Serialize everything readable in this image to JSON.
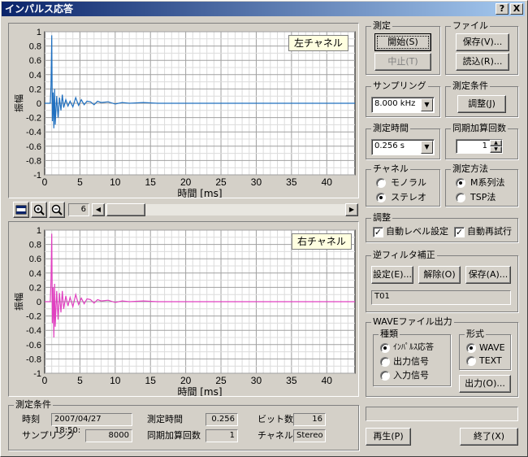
{
  "window": {
    "title": "インパルス応答",
    "help_button": "?",
    "close_button": "X"
  },
  "charts": {
    "left_label": "左チャネル",
    "right_label": "右チャネル",
    "zoom_value": "6"
  },
  "chart_data": [
    {
      "type": "line",
      "title": "左チャネル",
      "xlabel": "時間 [ms]",
      "ylabel": "振幅",
      "xlim": [
        0,
        44
      ],
      "ylim": [
        -1,
        1
      ],
      "x_ticks": [
        "0",
        "5",
        "10",
        "15",
        "20",
        "25",
        "30",
        "35",
        "40"
      ],
      "y_ticks": [
        "1",
        "0.8",
        "0.6",
        "0.4",
        "0.2",
        "0",
        "-0.2",
        "-0.4",
        "-0.6",
        "-0.8",
        "-1"
      ],
      "grid": true,
      "color": "#1f6fbf",
      "series": [
        {
          "x": [
            0,
            0.8,
            0.9,
            1.0,
            1.05,
            1.1,
            1.2,
            1.3,
            1.4,
            1.5,
            1.7,
            1.9,
            2.1,
            2.3,
            2.5,
            2.7,
            3.0,
            3.3,
            3.6,
            4.0,
            4.4,
            4.8,
            5.2,
            5.6,
            6.0,
            6.5,
            7.0,
            7.5,
            8.0,
            9.0,
            10.0,
            11.0,
            12.0,
            14.0,
            16.0,
            20.0,
            25.0,
            30.0,
            35.0,
            40.0,
            44.0
          ],
          "y": [
            0,
            0,
            0.25,
            0.95,
            0.3,
            -0.25,
            0.15,
            -0.35,
            0.2,
            -0.3,
            0.1,
            -0.2,
            0.08,
            -0.1,
            0.12,
            -0.06,
            0.05,
            -0.04,
            0.03,
            -0.05,
            0.08,
            -0.03,
            0.05,
            -0.02,
            0.03,
            0.02,
            -0.02,
            0.03,
            0.01,
            0.02,
            -0.01,
            0.01,
            0.0,
            0.01,
            0.0,
            0.0,
            0.0,
            0.0,
            0.0,
            0.0,
            0.0
          ]
        }
      ]
    },
    {
      "type": "line",
      "title": "右チャネル",
      "xlabel": "時間 [ms]",
      "ylabel": "振幅",
      "xlim": [
        0,
        44
      ],
      "ylim": [
        -1,
        1
      ],
      "x_ticks": [
        "0",
        "5",
        "10",
        "15",
        "20",
        "25",
        "30",
        "35",
        "40"
      ],
      "y_ticks": [
        "1",
        "0.8",
        "0.6",
        "0.4",
        "0.2",
        "0",
        "-0.2",
        "-0.4",
        "-0.6",
        "-0.8",
        "-1"
      ],
      "grid": true,
      "color": "#e040c0",
      "series": [
        {
          "x": [
            0,
            0.8,
            0.9,
            1.0,
            1.05,
            1.1,
            1.2,
            1.3,
            1.4,
            1.5,
            1.7,
            1.9,
            2.1,
            2.3,
            2.5,
            2.7,
            3.0,
            3.3,
            3.6,
            4.0,
            4.4,
            4.8,
            5.2,
            5.6,
            6.0,
            6.5,
            7.0,
            7.5,
            8.0,
            9.0,
            10.0,
            11.0,
            12.0,
            14.0,
            16.0,
            20.0,
            25.0,
            30.0,
            35.0,
            40.0,
            44.0
          ],
          "y": [
            0,
            0,
            0.3,
            0.95,
            0.35,
            -0.3,
            0.2,
            -0.5,
            0.25,
            -0.35,
            0.15,
            -0.25,
            0.12,
            -0.15,
            0.15,
            -0.1,
            0.08,
            -0.06,
            0.06,
            -0.07,
            0.1,
            -0.04,
            0.05,
            -0.03,
            0.04,
            0.03,
            -0.02,
            0.03,
            0.01,
            0.02,
            -0.01,
            0.01,
            0.0,
            0.01,
            0.0,
            0.0,
            0.0,
            0.0,
            0.0,
            0.0,
            0.0
          ]
        }
      ]
    }
  ],
  "measure": {
    "group": "測定",
    "start": "開始(S)",
    "stop": "中止(T)"
  },
  "file": {
    "group": "ファイル",
    "save": "保存(V)...",
    "load": "読込(R)..."
  },
  "sampling": {
    "group": "サンプリング",
    "value": "8.000 kHz"
  },
  "conditions": {
    "group": "測定条件",
    "adjust": "調整(J)"
  },
  "measure_time": {
    "group": "測定時間",
    "value": "0.256 s"
  },
  "sync_add": {
    "group": "同期加算回数",
    "value": "1"
  },
  "channel": {
    "group": "チャネル",
    "options": [
      "モノラル",
      "ステレオ"
    ],
    "selected": 1
  },
  "method": {
    "group": "測定方法",
    "options": [
      "M系列法",
      "TSP法"
    ],
    "selected": 0
  },
  "adjust": {
    "group": "調整",
    "auto_level": "自動レベル設定",
    "auto_retry": "自動再試行"
  },
  "inverse_filter": {
    "group": "逆フィルタ補正",
    "set": "設定(E)...",
    "release": "解除(O)",
    "save": "保存(A)...",
    "value": "T01"
  },
  "wave_out": {
    "group": "WAVEファイル出力",
    "kind_group": "種類",
    "kinds": [
      "ｲﾝﾊﾟﾙｽ応答",
      "出力信号",
      "入力信号"
    ],
    "kind_selected": 0,
    "format_group": "形式",
    "formats": [
      "WAVE",
      "TEXT"
    ],
    "format_selected": 0,
    "output": "出力(O)..."
  },
  "summary": {
    "group": "測定条件",
    "time_label": "時刻",
    "time_value": "2007/04/27 18:50:",
    "mtime_label": "測定時間",
    "mtime_value": "0.256",
    "bits_label": "ビット数",
    "bits_value": "16",
    "sampling_label": "サンプリング",
    "sampling_value": "8000",
    "sync_label": "同期加算回数",
    "sync_value": "1",
    "channel_label": "チャネル",
    "channel_value": "Stereo"
  },
  "footer": {
    "play": "再生(P)",
    "exit": "終了(X)"
  }
}
